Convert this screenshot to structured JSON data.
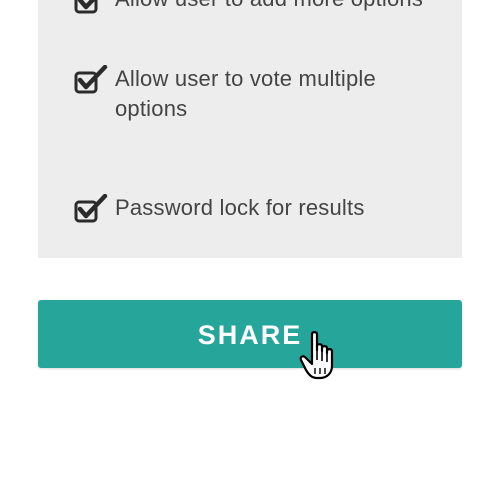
{
  "options": [
    {
      "label": "Allow user to add more options",
      "checked": true
    },
    {
      "label": "Allow user to vote multiple options",
      "checked": true
    },
    {
      "label": "Password lock for results",
      "checked": true
    }
  ],
  "share_button": {
    "label": "SHARE"
  },
  "colors": {
    "panel_background": "#ededed",
    "button_background": "#26a69a",
    "text": "#444444",
    "checkbox": "#2b2b2b"
  },
  "icons": {
    "checkbox": "checkbox-checked-icon",
    "cursor": "hand-pointer-cursor-icon"
  }
}
